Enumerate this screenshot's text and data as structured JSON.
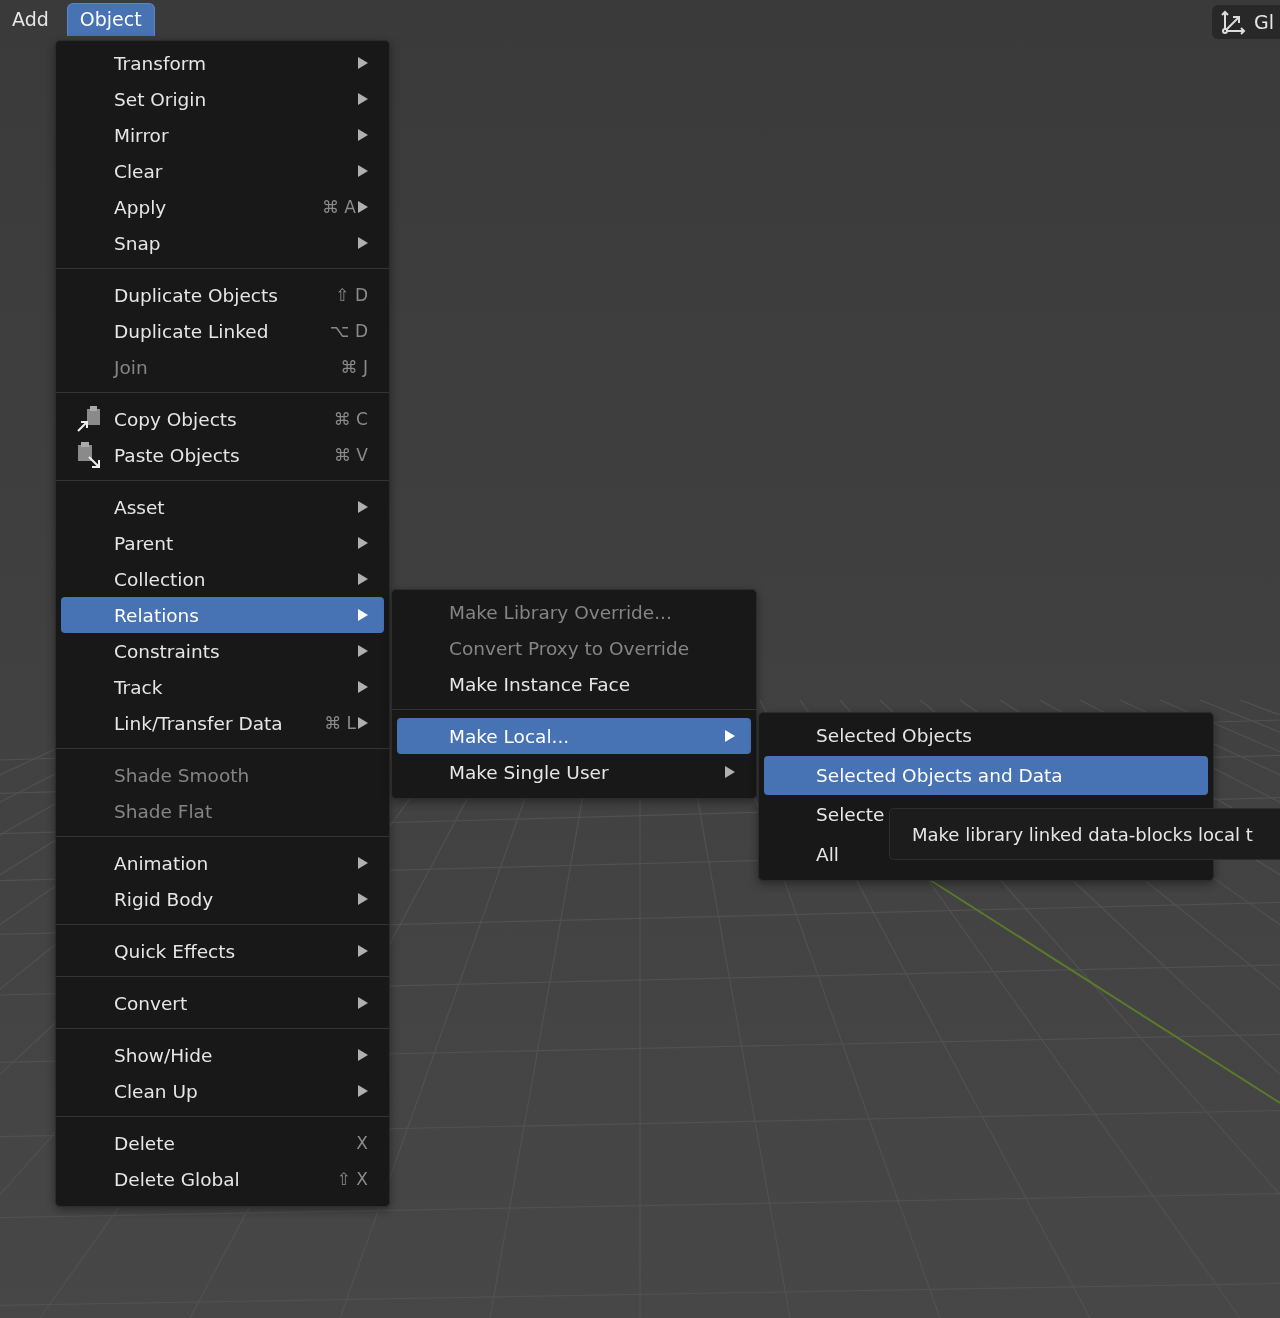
{
  "menubar": [
    {
      "label": "Add",
      "selected": false
    },
    {
      "label": "Object",
      "selected": true
    }
  ],
  "header_button": {
    "label": "Gl"
  },
  "object_menu": {
    "sections": [
      {
        "items": [
          {
            "kind": "plain",
            "label": "Transform",
            "submenu": true,
            "disabled": false,
            "selected": false
          },
          {
            "kind": "plain",
            "label": "Set Origin",
            "submenu": true,
            "disabled": false,
            "selected": false
          },
          {
            "kind": "plain",
            "label": "Mirror",
            "submenu": true,
            "disabled": false,
            "selected": false
          },
          {
            "kind": "plain",
            "label": "Clear",
            "submenu": true,
            "disabled": false,
            "selected": false
          },
          {
            "kind": "plain",
            "label": "Apply",
            "shortcut": "⌘ A",
            "submenu": true,
            "disabled": false,
            "selected": false
          },
          {
            "kind": "plain",
            "label": "Snap",
            "submenu": true,
            "disabled": false,
            "selected": false
          }
        ]
      },
      {
        "items": [
          {
            "kind": "plain",
            "label": "Duplicate Objects",
            "shortcut": "⇧ D",
            "submenu": false,
            "disabled": false,
            "selected": false
          },
          {
            "kind": "plain",
            "label": "Duplicate Linked",
            "shortcut": "⌥ D",
            "submenu": false,
            "disabled": false,
            "selected": false
          },
          {
            "kind": "plain",
            "label": "Join",
            "shortcut": "⌘ J",
            "submenu": false,
            "disabled": true,
            "selected": false
          }
        ]
      },
      {
        "items": [
          {
            "kind": "icon",
            "label": "Copy Objects",
            "shortcut": "⌘ C",
            "submenu": false,
            "disabled": false,
            "selected": false
          },
          {
            "kind": "icon",
            "label": "Paste Objects",
            "shortcut": "⌘ V",
            "submenu": false,
            "disabled": false,
            "selected": false
          }
        ]
      },
      {
        "items": [
          {
            "kind": "plain",
            "label": "Asset",
            "submenu": true,
            "disabled": false,
            "selected": false
          },
          {
            "kind": "plain",
            "label": "Parent",
            "submenu": true,
            "disabled": false,
            "selected": false
          },
          {
            "kind": "plain",
            "label": "Collection",
            "submenu": true,
            "disabled": false,
            "selected": false
          },
          {
            "kind": "plain",
            "label": "Relations",
            "submenu": true,
            "disabled": false,
            "selected": true
          },
          {
            "kind": "plain",
            "label": "Constraints",
            "submenu": true,
            "disabled": false,
            "selected": false
          },
          {
            "kind": "plain",
            "label": "Track",
            "submenu": true,
            "disabled": false,
            "selected": false
          },
          {
            "kind": "plain",
            "label": "Link/Transfer Data",
            "shortcut": "⌘ L",
            "submenu": true,
            "disabled": false,
            "selected": false
          }
        ]
      },
      {
        "items": [
          {
            "kind": "plain",
            "label": "Shade Smooth",
            "submenu": false,
            "disabled": true,
            "selected": false
          },
          {
            "kind": "plain",
            "label": "Shade Flat",
            "submenu": false,
            "disabled": true,
            "selected": false
          }
        ]
      },
      {
        "items": [
          {
            "kind": "plain",
            "label": "Animation",
            "submenu": true,
            "disabled": false,
            "selected": false
          },
          {
            "kind": "plain",
            "label": "Rigid Body",
            "submenu": true,
            "disabled": false,
            "selected": false
          }
        ]
      },
      {
        "items": [
          {
            "kind": "plain",
            "label": "Quick Effects",
            "submenu": true,
            "disabled": false,
            "selected": false
          }
        ]
      },
      {
        "items": [
          {
            "kind": "plain",
            "label": "Convert",
            "submenu": true,
            "disabled": false,
            "selected": false
          }
        ]
      },
      {
        "items": [
          {
            "kind": "plain",
            "label": "Show/Hide",
            "submenu": true,
            "disabled": false,
            "selected": false
          },
          {
            "kind": "plain",
            "label": "Clean Up",
            "submenu": true,
            "disabled": false,
            "selected": false
          }
        ]
      },
      {
        "items": [
          {
            "kind": "plain",
            "label": "Delete",
            "shortcut": "X",
            "submenu": false,
            "disabled": false,
            "selected": false
          },
          {
            "kind": "plain",
            "label": "Delete Global",
            "shortcut": "⇧ X",
            "submenu": false,
            "disabled": false,
            "selected": false
          }
        ]
      }
    ]
  },
  "relations_menu": {
    "sections": [
      {
        "items": [
          {
            "label": "Make Library Override...",
            "submenu": false,
            "disabled": true,
            "selected": false
          },
          {
            "label": "Convert Proxy to Override",
            "submenu": false,
            "disabled": true,
            "selected": false
          },
          {
            "label": "Make Instance Face",
            "submenu": false,
            "disabled": false,
            "selected": false
          }
        ]
      },
      {
        "items": [
          {
            "label": "Make Local...",
            "submenu": true,
            "disabled": false,
            "selected": true
          },
          {
            "label": "Make Single User",
            "submenu": true,
            "disabled": false,
            "selected": false
          }
        ]
      }
    ]
  },
  "make_local_menu": {
    "sections": [
      {
        "items": [
          {
            "label": "Selected Objects",
            "disabled": false,
            "selected": false
          },
          {
            "label": "Selected Objects and Data",
            "disabled": false,
            "selected": true
          },
          {
            "label": "Selecte",
            "disabled": false,
            "selected": false
          },
          {
            "label": "All",
            "disabled": false,
            "selected": false
          }
        ]
      }
    ]
  },
  "tooltip": {
    "text": "Make library linked data-blocks local t"
  }
}
